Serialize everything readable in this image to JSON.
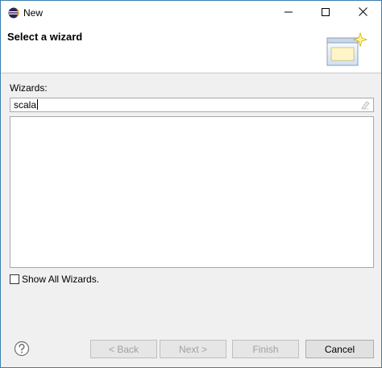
{
  "window": {
    "title": "New",
    "icons": {
      "app": "eclipse-icon",
      "minimize": "minimize-icon",
      "maximize": "maximize-icon",
      "close": "close-icon"
    }
  },
  "banner": {
    "title": "Select a wizard",
    "image": "new-wizard-banner-icon"
  },
  "wizards": {
    "label": "Wizards:",
    "filter_value": "scala",
    "clear_icon": "clear-filter-icon",
    "items": []
  },
  "show_all": {
    "label": "Show All Wizards.",
    "checked": false
  },
  "buttons": {
    "help_icon": "help-icon",
    "back": "< Back",
    "next": "Next >",
    "finish": "Finish",
    "cancel": "Cancel"
  },
  "colors": {
    "window_border": "#3c7fb1",
    "dialog_bg": "#f0f0f0",
    "disabled_text": "#a0a0a0"
  }
}
